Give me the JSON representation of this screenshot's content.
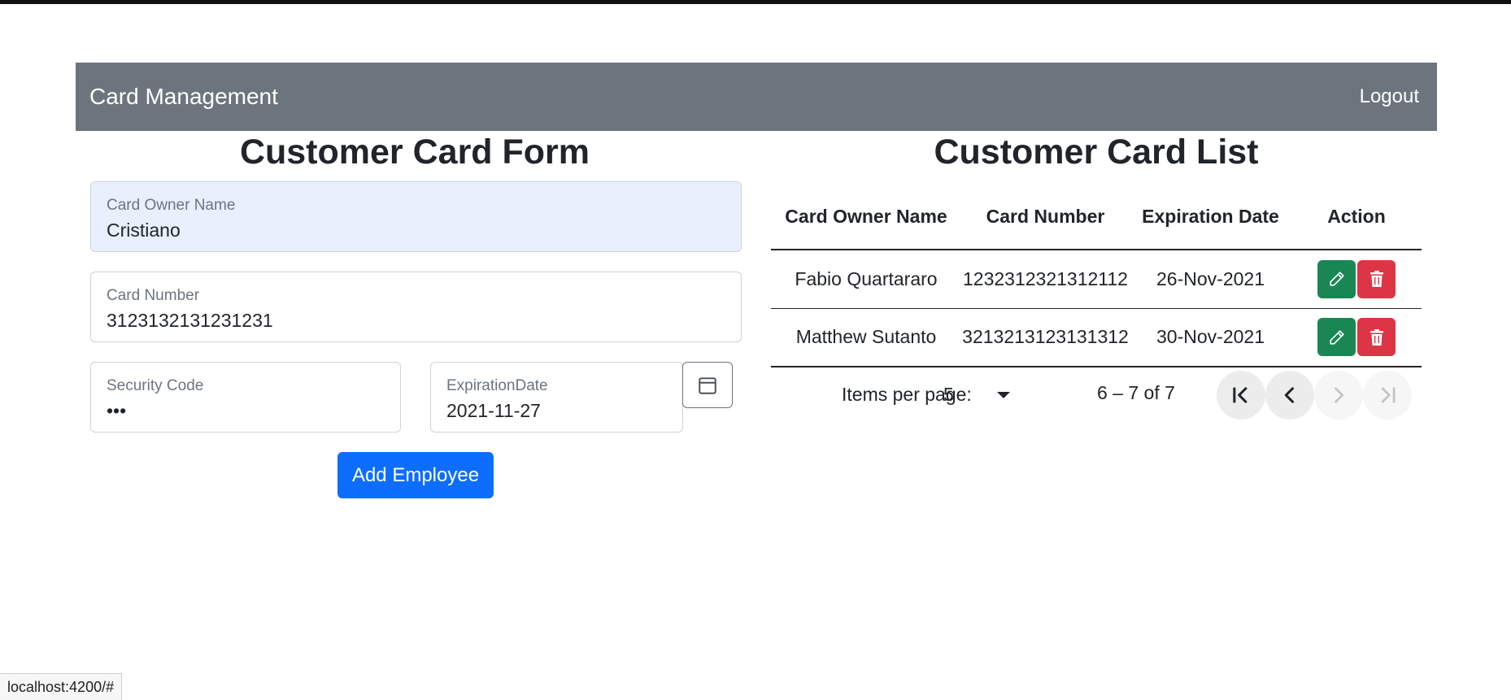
{
  "navbar": {
    "brand": "Card Management",
    "logout": "Logout"
  },
  "form": {
    "title": "Customer Card Form",
    "fields": {
      "owner": {
        "label": "Card Owner Name",
        "value": "Cristiano"
      },
      "number": {
        "label": "Card Number",
        "value": "3123132131231231"
      },
      "security": {
        "label": "Security Code",
        "value": "•••"
      },
      "expiration": {
        "label": "ExpirationDate",
        "value": "2021-11-27"
      }
    },
    "submit_label": "Add Employee"
  },
  "list": {
    "title": "Customer Card List",
    "headers": {
      "owner": "Card Owner Name",
      "number": "Card Number",
      "expiration": "Expiration Date",
      "action": "Action"
    },
    "rows": [
      {
        "owner": "Fabio Quartararo",
        "number": "1232312321312112",
        "expiration": "26-Nov-2021"
      },
      {
        "owner": "Matthew Sutanto",
        "number": "3213213123131312",
        "expiration": "30-Nov-2021"
      }
    ]
  },
  "paginator": {
    "items_per_page_label": "Items per page:",
    "page_size": "5",
    "range": "6 – 7 of 7"
  },
  "status_bar": {
    "url": "localhost:4200/#"
  },
  "colors": {
    "navbar": "#6c757d",
    "primary": "#0d6efd",
    "edit": "#198754",
    "delete": "#dc3545",
    "autofill": "#e8f0fe"
  },
  "icons": {
    "calendar": "calendar-icon",
    "edit": "pencil-icon",
    "delete": "trash-icon",
    "first": "first-page-icon",
    "prev": "chevron-left-icon",
    "next": "chevron-right-icon",
    "last": "last-page-icon"
  }
}
